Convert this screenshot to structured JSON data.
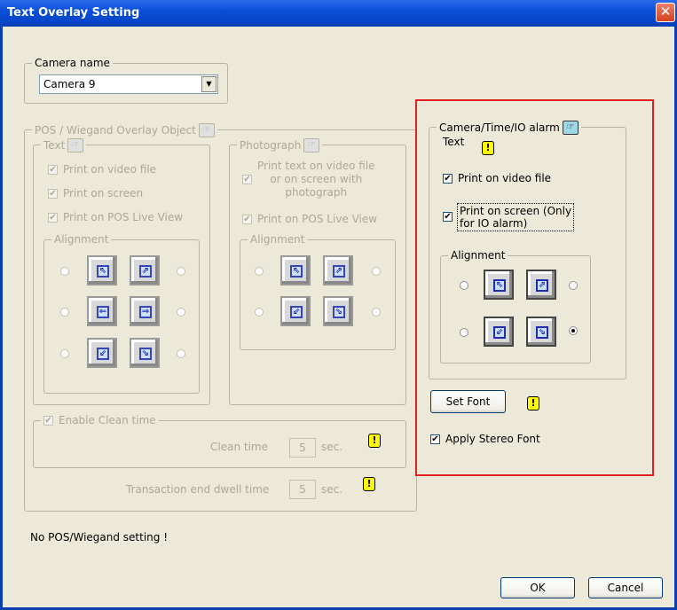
{
  "window": {
    "title": "Text Overlay Setting",
    "close_glyph": "✕"
  },
  "camera": {
    "group_label": "Camera name",
    "selected": "Camera 9"
  },
  "pos": {
    "group_label": "POS / Wiegand Overlay Object",
    "text_group_label": "Text",
    "text_checks": [
      "Print on video file",
      "Print on screen",
      "Print on POS Live View"
    ],
    "photo_group_label": "Photograph",
    "photo_check_1": [
      "Print text on video file",
      "or on screen with",
      "photograph"
    ],
    "photo_check_2": "Print on POS Live View",
    "alignment_label": "Alignment",
    "enable_clean_label": "Enable Clean time",
    "clean_time_label": "Clean time",
    "clean_time_value": "5",
    "sec_label": "sec.",
    "dwell_label": "Transaction end dwell time",
    "dwell_value": "5"
  },
  "cam_text": {
    "group_label": "Camera/Time/IO alarm",
    "group_label_2": "Text",
    "print_video": "Print on video file",
    "print_screen": [
      "Print on screen (Only",
      "for IO alarm)"
    ],
    "alignment_label": "Alignment",
    "set_font": "Set Font",
    "apply_stereo": "Apply Stereo Font"
  },
  "status": "No POS/Wiegand setting !",
  "buttons": {
    "ok": "OK",
    "cancel": "Cancel"
  },
  "icons": {
    "check": "✔",
    "warn": "!",
    "dropdown": "▼",
    "hand": "☞"
  },
  "arrows": {
    "nw": "⇖",
    "ne": "⇗",
    "w": "⇐",
    "e": "⇒",
    "sw": "⇙",
    "se": "⇘"
  },
  "colors": {
    "title_bar": "#0a4ed8",
    "dialog_bg": "#ece9d8",
    "highlight_box": "#e32020",
    "warning": "#ffff00"
  }
}
